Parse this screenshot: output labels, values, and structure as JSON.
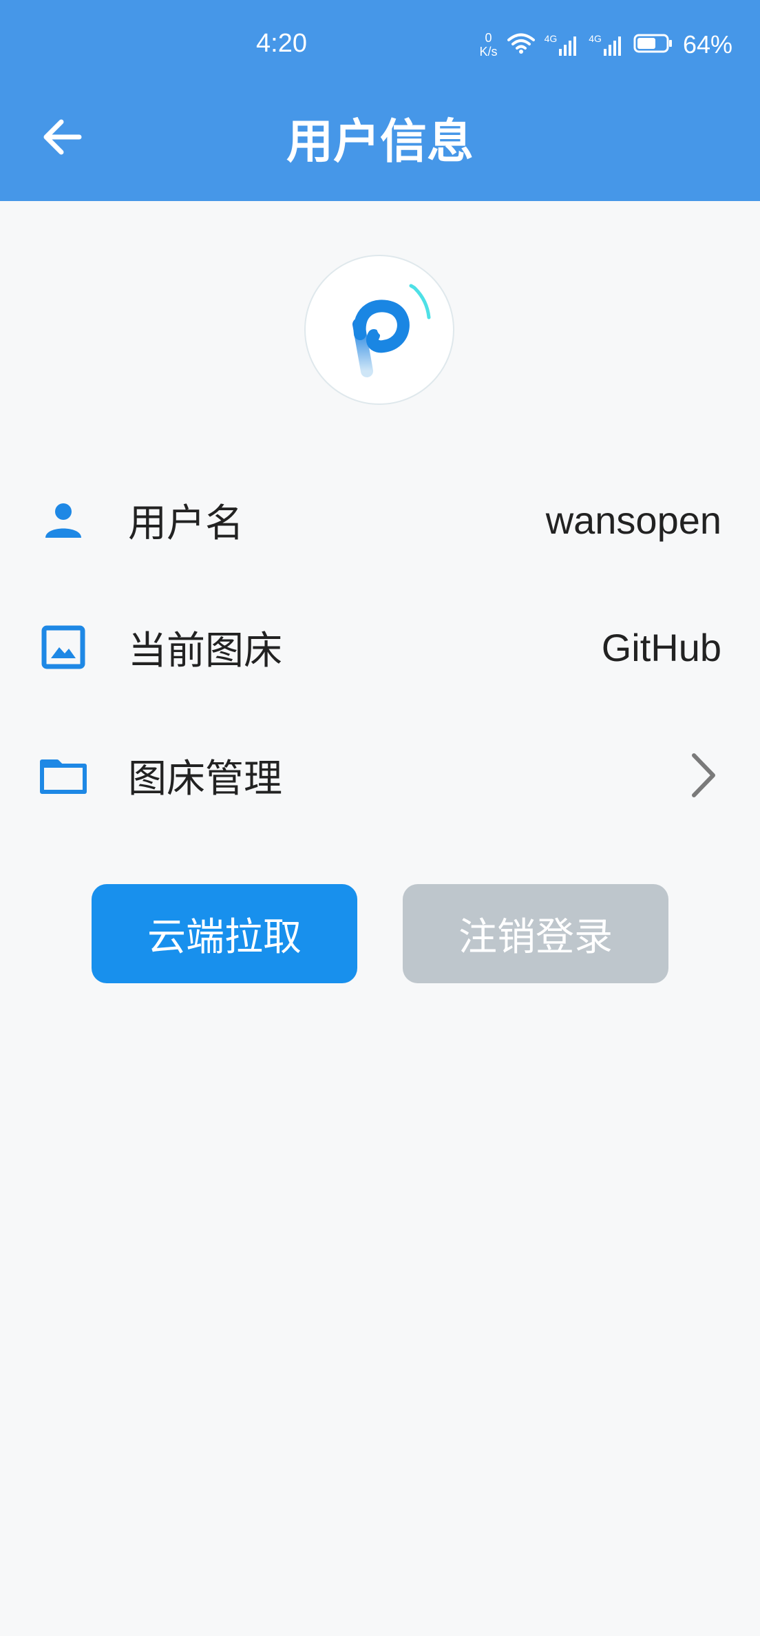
{
  "status_bar": {
    "time": "4:20",
    "net_speed_value": "0",
    "net_speed_unit": "K/s",
    "sim1_tag": "4G",
    "sim2_tag": "4G",
    "battery_percent": "64%",
    "battery_level": 0.64
  },
  "header": {
    "title": "用户信息",
    "bg_color": "#4697e8"
  },
  "rows": [
    {
      "icon": "person-icon",
      "label": "用户名",
      "value": "wansopen"
    },
    {
      "icon": "image-icon",
      "label": "当前图床",
      "value": "GitHub"
    },
    {
      "icon": "folder-icon",
      "label": "图床管理",
      "value": ""
    }
  ],
  "buttons": {
    "pull_label": "云端拉取",
    "logout_label": "注销登录",
    "primary_color": "#1890ed",
    "disabled_color": "#bec6cc"
  },
  "accent_color": "#1e88e5"
}
